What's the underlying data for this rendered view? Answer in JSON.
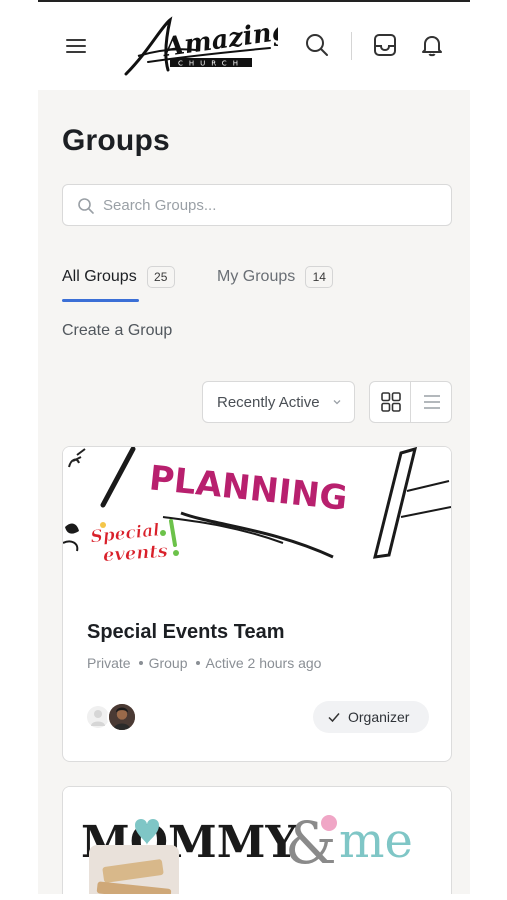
{
  "header": {
    "logo_text": "Amazing",
    "logo_subtext": "CHURCH",
    "icons": [
      "menu-icon",
      "search-icon",
      "inbox-icon",
      "bell-icon"
    ]
  },
  "page": {
    "title": "Groups"
  },
  "search": {
    "placeholder": "Search Groups..."
  },
  "tabs": [
    {
      "label": "All Groups",
      "count": "25",
      "active": true
    },
    {
      "label": "My Groups",
      "count": "14",
      "active": false
    }
  ],
  "create_link": "Create a Group",
  "sort": {
    "selected": "Recently Active"
  },
  "view": {
    "mode": "grid"
  },
  "groups": [
    {
      "cover_text": "PLANNING",
      "avatar_text_1": "Special",
      "avatar_text_2": "events",
      "name": "Special Events Team",
      "privacy": "Private",
      "type": "Group",
      "activity": "Active 2 hours ago",
      "role": "Organizer"
    },
    {
      "cover_text_1": "MOMMY",
      "cover_text_2": "&",
      "cover_text_3": "me"
    }
  ],
  "colors": {
    "accent": "#3b6fd6",
    "page_bg": "#f6f5f3",
    "planning_magenta": "#b8206e",
    "mommy_teal": "#7fc6c6"
  }
}
